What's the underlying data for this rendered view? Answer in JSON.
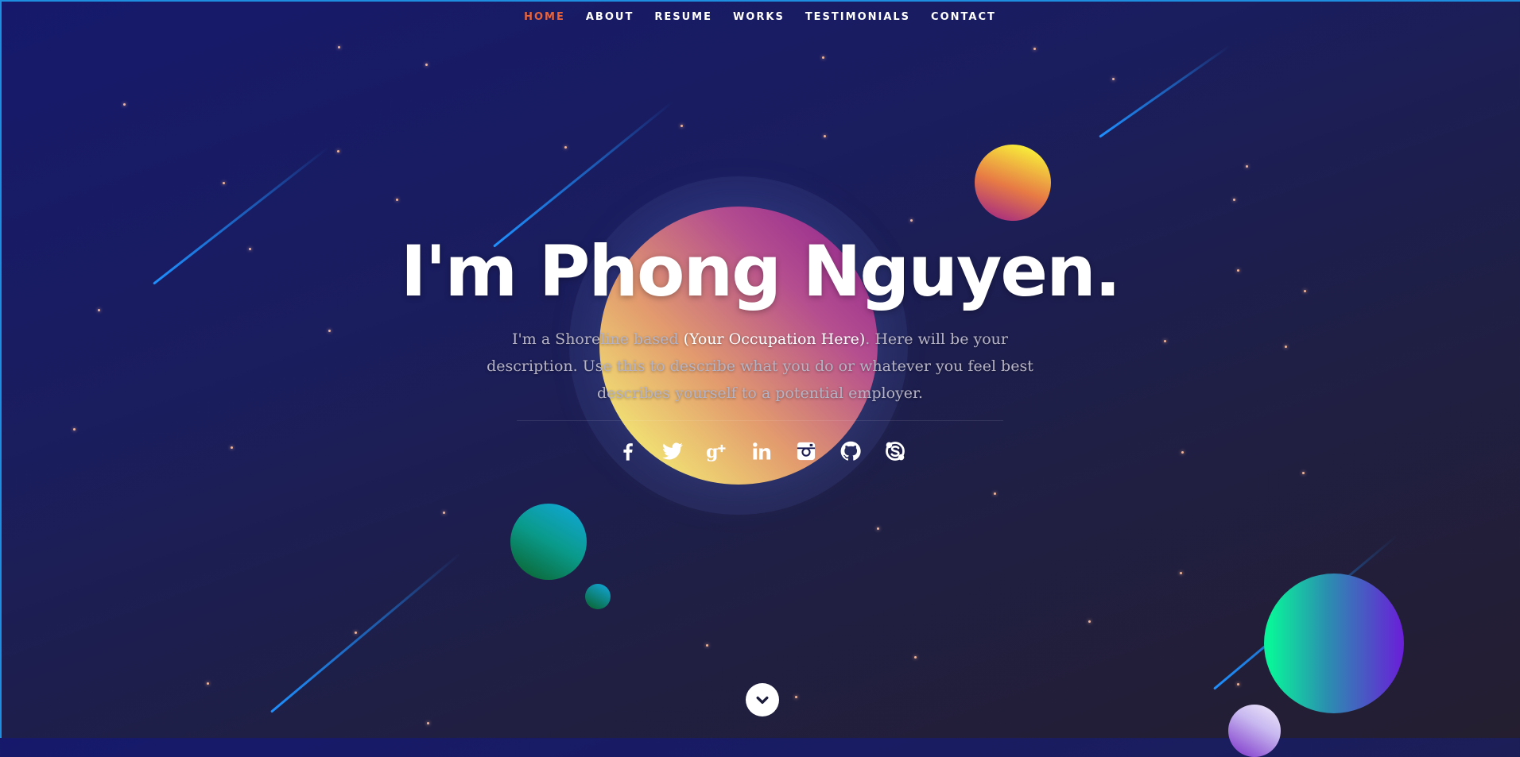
{
  "nav": {
    "items": [
      {
        "label": "HOME",
        "active": true
      },
      {
        "label": "ABOUT"
      },
      {
        "label": "RESUME"
      },
      {
        "label": "WORKS"
      },
      {
        "label": "TESTIMONIALS"
      },
      {
        "label": "CONTACT"
      }
    ]
  },
  "hero": {
    "title": "I'm Phong Nguyen.",
    "desc_before": "I'm a Shoreline based ",
    "desc_highlight": "(Your Occupation Here)",
    "desc_after": ". Here will be your description. Use this to describe what you do or whatever you feel best describes yourself to a potential employer."
  },
  "socials": [
    {
      "icon": "facebook-icon"
    },
    {
      "icon": "twitter-icon"
    },
    {
      "icon": "google-plus-icon"
    },
    {
      "icon": "linkedin-icon"
    },
    {
      "icon": "instagram-icon"
    },
    {
      "icon": "github-icon"
    },
    {
      "icon": "skype-icon"
    }
  ],
  "scroll": {
    "icon": "chevron-down-icon"
  },
  "colors": {
    "active_nav": "#e8633a",
    "accent_line": "#1e8fe0",
    "background_top": "#16196b",
    "background_bottom": "#241e30"
  }
}
